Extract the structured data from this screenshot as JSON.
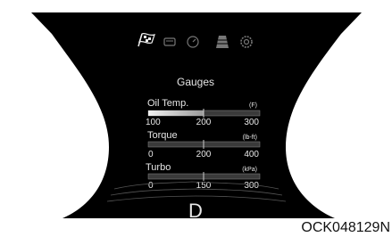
{
  "screen": {
    "title": "Gauges",
    "gear": "D",
    "mode_icons": [
      "checkered-flag-icon",
      "car-body-icon",
      "speedometer-icon",
      "road-lane-icon",
      "settings-gear-icon"
    ],
    "active_mode_icon": "checkered-flag-icon"
  },
  "gauges": [
    {
      "label": "Oil Temp.",
      "unit": "(F)",
      "ticks": [
        "100",
        "200",
        "300"
      ],
      "level": 0.5
    },
    {
      "label": "Torque",
      "unit": "(lb-ft)",
      "ticks": [
        "0",
        "200",
        "400"
      ],
      "level": 0.0
    },
    {
      "label": "Turbo",
      "unit": "(kPa)",
      "ticks": [
        "0",
        "150",
        "300"
      ],
      "level": 0.0
    }
  ],
  "caption": "OCK048129N",
  "colors": {
    "background": "#000000",
    "text": "#e6e6e6",
    "frame": "#ffffff"
  }
}
